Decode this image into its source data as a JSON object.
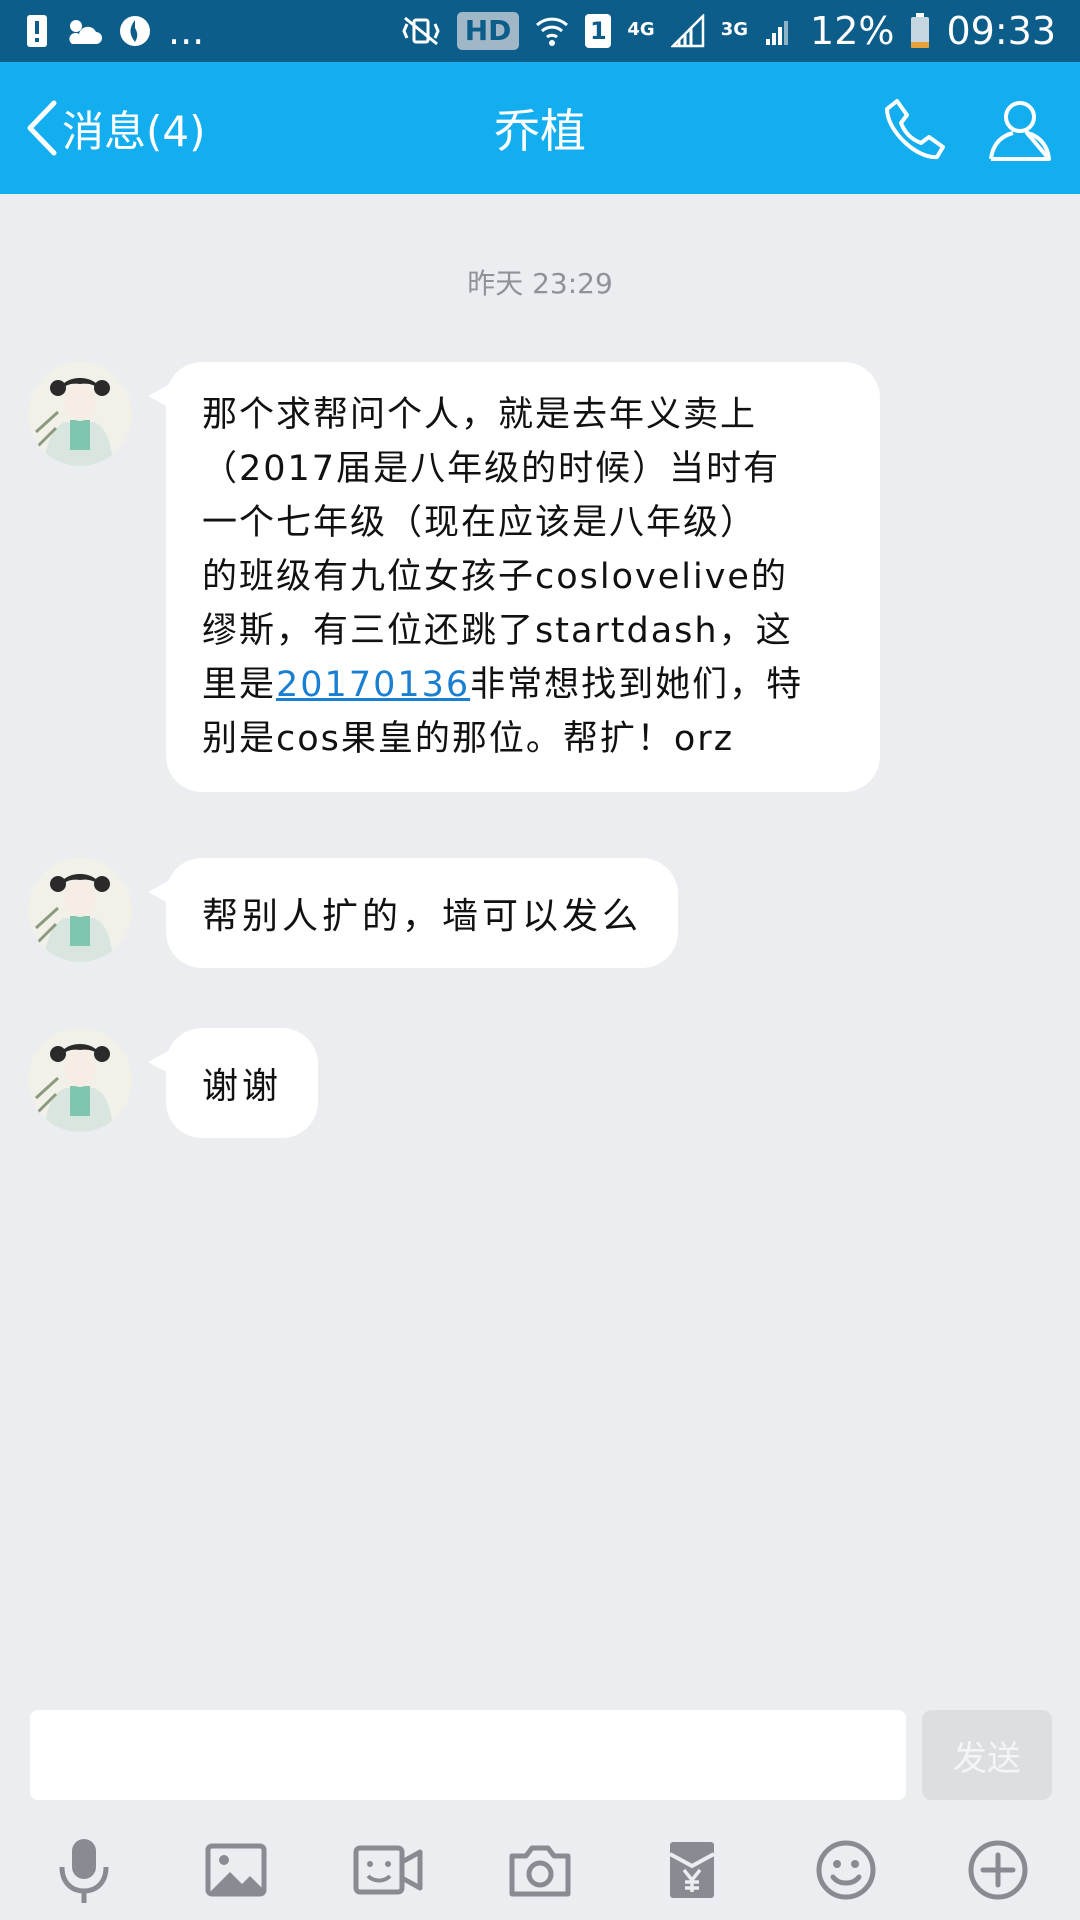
{
  "status_bar": {
    "hd": "HD",
    "sim": "1",
    "net1": "4G",
    "net2": "3G",
    "battery": "12%",
    "time": "09:33",
    "more": "...",
    "colors": {
      "background": "#0d5d8a"
    }
  },
  "header": {
    "back_label": "消息(4)",
    "title": "乔植",
    "icons": [
      "phone-icon",
      "profile-icon"
    ],
    "colors": {
      "background": "#13aef0"
    }
  },
  "chat": {
    "timestamp": "昨天 23:29",
    "messages": [
      {
        "lines": [
          "那个求帮问个人，就是去年义卖上",
          "（2017届是八年级的时候）当时有",
          "一个七年级（现在应该是八年级）",
          "的班级有九位女孩子coslovelive的",
          "缪斯，有三位还跳了startdash，这",
          {
            "before": "里是",
            "link": "20170136",
            "after": "非常想找到她们，特"
          },
          "别是cos果皇的那位。帮扩！orz"
        ]
      },
      {
        "text": "帮别人扩的，墙可以发么"
      },
      {
        "text": "谢谢"
      }
    ]
  },
  "composer": {
    "send_label": "发送",
    "toolbar_icons": [
      "microphone-icon",
      "image-icon",
      "video-call-icon",
      "camera-icon",
      "red-packet-icon",
      "emoji-icon",
      "plus-icon"
    ]
  }
}
